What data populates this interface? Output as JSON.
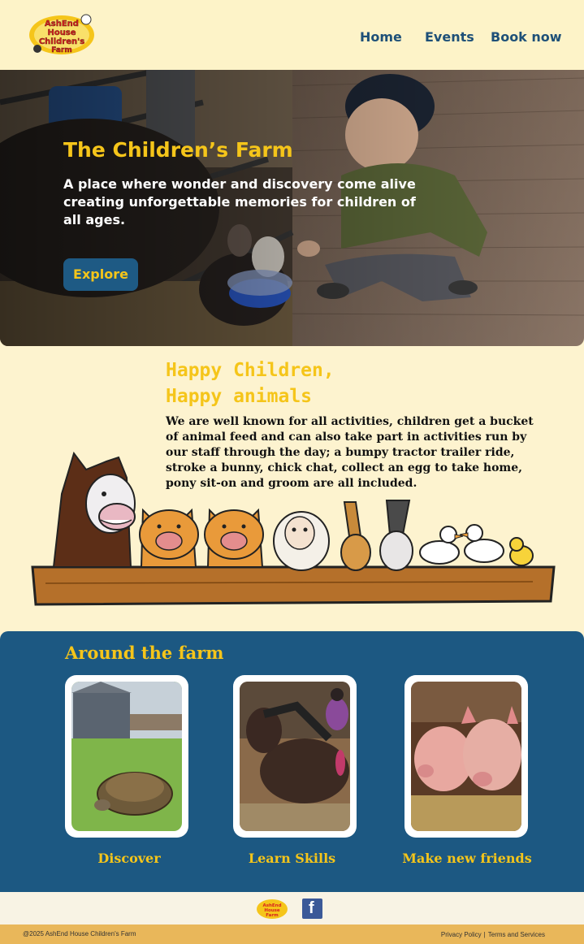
{
  "header": {
    "logo_text": "AshEnd House Children's Farm",
    "nav": [
      {
        "label": "Home"
      },
      {
        "label": "Events"
      },
      {
        "label": "Book now"
      }
    ]
  },
  "hero": {
    "title": "The Children’s Farm",
    "subtitle": "A place where wonder and discovery come alive creating unforgettable memories for children of all ages.",
    "button": "Explore"
  },
  "intro": {
    "title_line1": "Happy Children,",
    "title_line2": "Happy animals",
    "text": "We are well known for all activities, children get a bucket of animal feed and can also take part in activities run by our staff through the day; a bumpy tractor trailer ride, stroke a bunny, chick chat, collect an egg to take home, pony sit-on and groom are all included."
  },
  "around": {
    "title": "Around the farm",
    "cards": [
      {
        "label": "Discover"
      },
      {
        "label": "Learn Skills"
      },
      {
        "label": "Make new friends"
      }
    ]
  },
  "footer": {
    "facebook_icon": "f",
    "copyright": "@2025 AshEnd House Children's Farm",
    "privacy": "Privacy Policy",
    "separator": "|",
    "terms": "Terms and Services"
  },
  "colors": {
    "accent": "#f5c51a",
    "navy": "#1e5078",
    "section_bg": "#1c5882",
    "cream": "#fdf3cf",
    "footer_bar": "#e9b75a"
  }
}
